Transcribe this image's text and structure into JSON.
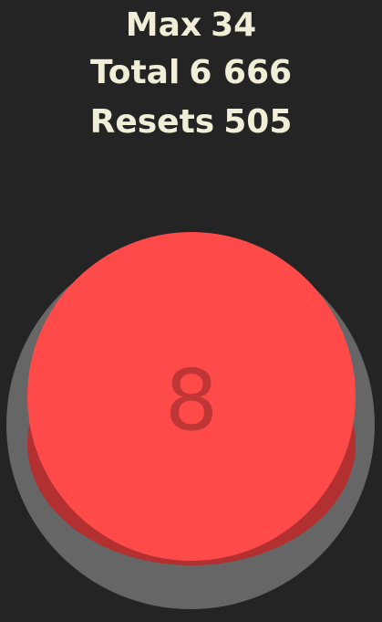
{
  "stats": {
    "max_label": "Max",
    "max_value": "34",
    "total_label": "Total",
    "total_value": "6 666",
    "resets_label": "Resets",
    "resets_value": "505"
  },
  "counter": {
    "value": "8"
  },
  "colors": {
    "background": "#242424",
    "stats_text": "#F1EED8",
    "button_base": "#666666",
    "button_top": "#FF4A4A",
    "button_side": "#B23030",
    "counter_text": "#C03636"
  },
  "icons": {}
}
